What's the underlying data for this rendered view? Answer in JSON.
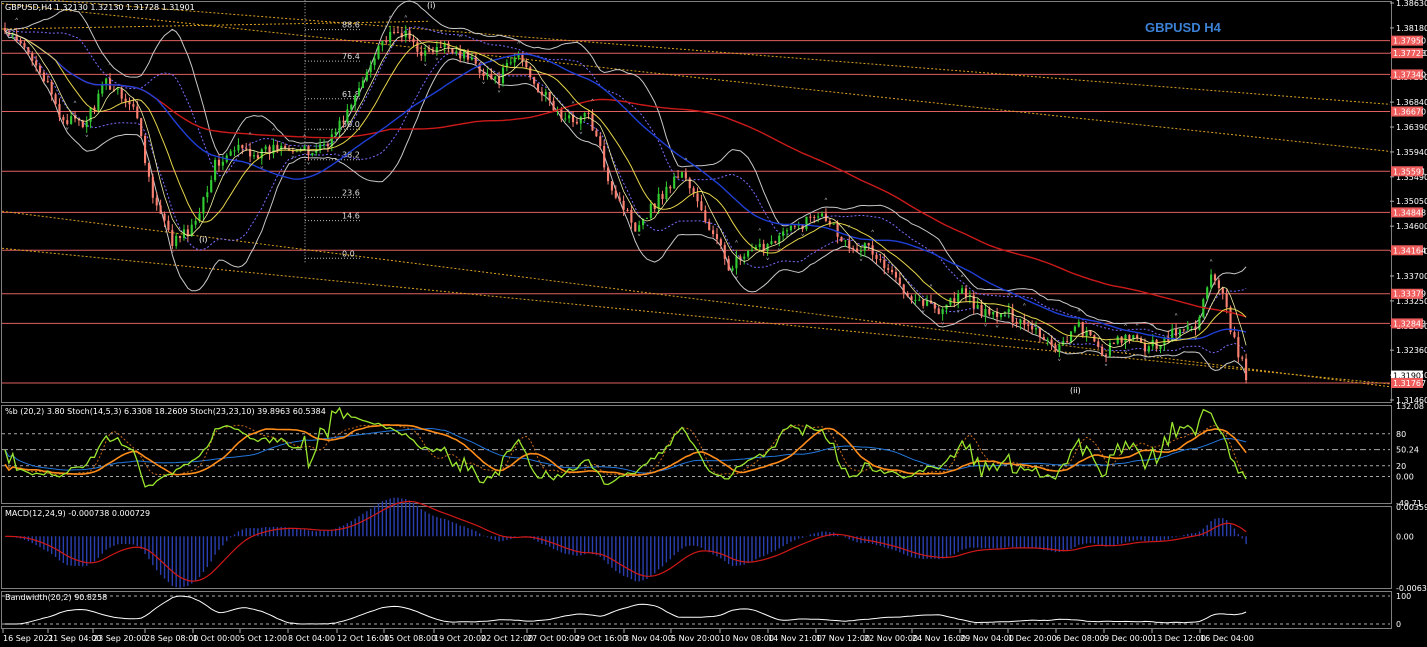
{
  "window": {
    "main_header": "GBPUSD,H4  1.32130 1.32130 1.31728 1.31901",
    "symbol_label": "GBPUSD H4",
    "wave_labels": [
      "(i)",
      "(i)",
      "(ii)"
    ]
  },
  "colors": {
    "background": "#000000",
    "bull_candle": "#32cd32",
    "bear_candle": "#fa8072",
    "ma_long": "#cc1a1a",
    "ma_mid": "#1f3fd6",
    "ma_short": "#e6d54a",
    "bollinger": "#c8c8c8",
    "hline": "#e06060",
    "channel": "#d9a020",
    "label_blue": "#3b82d6",
    "stoch_main": "#9ae62e",
    "stoch_orange": "#ff8c1a",
    "stoch_blue": "#2277dd",
    "macd_hist": "#2a3fb0",
    "macd_signal": "#d01818"
  },
  "chart_data": [
    {
      "type": "candlestick",
      "title": "GBPUSD H4",
      "ylim": [
        1.3146,
        1.3863
      ],
      "y_ticks": [
        "1.38630",
        "1.38180",
        "1.37730",
        "1.37290",
        "1.36840",
        "1.36390",
        "1.35940",
        "1.35490",
        "1.35050",
        "1.34600",
        "1.34150",
        "1.33700",
        "1.33250",
        "1.32800",
        "1.32360",
        "1.31910",
        "1.31460"
      ],
      "price_labels": [
        {
          "value": 1.3795,
          "label": "1.37950",
          "style": "red"
        },
        {
          "value": 1.37723,
          "label": "1.37723",
          "style": "red"
        },
        {
          "value": 1.3734,
          "label": "1.37340",
          "style": "red"
        },
        {
          "value": 1.3667,
          "label": "1.36670",
          "style": "red"
        },
        {
          "value": 1.35591,
          "label": "1.35591",
          "style": "red"
        },
        {
          "value": 1.34848,
          "label": "1.34848",
          "style": "red"
        },
        {
          "value": 1.34164,
          "label": "1.34164",
          "style": "red"
        },
        {
          "value": 1.33379,
          "label": "1.33379",
          "style": "red"
        },
        {
          "value": 1.32843,
          "label": "1.32843",
          "style": "red"
        },
        {
          "value": 1.31901,
          "label": "1.31901",
          "style": "current"
        },
        {
          "value": 1.31767,
          "label": "1.31767",
          "style": "red"
        }
      ],
      "fib_levels": [
        "88.6",
        "76.4",
        "61.8",
        "50.0",
        "38.2",
        "23.6",
        "14.6",
        "0.0"
      ],
      "x_labels": [
        "16 Sep 2021",
        "21 Sep 04:00",
        "23 Sep 20:00",
        "28 Sep 08:00",
        "1 Oct 00:00",
        "5 Oct 12:00",
        "8 Oct 04:00",
        "12 Oct 16:00",
        "15 Oct 08:00",
        "19 Oct 20:00",
        "22 Oct 12:00",
        "27 Oct 00:00",
        "29 Oct 16:00",
        "3 Nov 04:00",
        "5 Nov 20:00",
        "10 Nov 08:00",
        "14 Nov 21:00",
        "17 Nov 12:00",
        "22 Nov 00:00",
        "24 Nov 16:00",
        "29 Nov 04:00",
        "1 Dec 20:00",
        "6 Dec 08:00",
        "9 Dec 00:00",
        "13 Dec 12:00",
        "16 Dec 04:00"
      ],
      "anchor_path": [
        [
          0,
          1.381
        ],
        [
          8,
          1.376
        ],
        [
          14,
          1.366
        ],
        [
          20,
          1.364
        ],
        [
          26,
          1.372
        ],
        [
          30,
          1.37
        ],
        [
          34,
          1.366
        ],
        [
          38,
          1.351
        ],
        [
          43,
          1.343
        ],
        [
          48,
          1.3455
        ],
        [
          54,
          1.357
        ],
        [
          60,
          1.36
        ],
        [
          66,
          1.359
        ],
        [
          72,
          1.361
        ],
        [
          78,
          1.359
        ],
        [
          84,
          1.362
        ],
        [
          90,
          1.369
        ],
        [
          96,
          1.379
        ],
        [
          102,
          1.381
        ],
        [
          108,
          1.377
        ],
        [
          114,
          1.3785
        ],
        [
          120,
          1.376
        ],
        [
          126,
          1.372
        ],
        [
          132,
          1.377
        ],
        [
          138,
          1.37
        ],
        [
          144,
          1.365
        ],
        [
          150,
          1.366
        ],
        [
          156,
          1.353
        ],
        [
          162,
          1.346
        ],
        [
          168,
          1.351
        ],
        [
          174,
          1.356
        ],
        [
          180,
          1.347
        ],
        [
          186,
          1.339
        ],
        [
          192,
          1.341
        ],
        [
          198,
          1.344
        ],
        [
          204,
          1.346
        ],
        [
          210,
          1.349
        ],
        [
          216,
          1.343
        ],
        [
          222,
          1.342
        ],
        [
          228,
          1.337
        ],
        [
          234,
          1.333
        ],
        [
          240,
          1.331
        ],
        [
          246,
          1.334
        ],
        [
          252,
          1.33
        ],
        [
          258,
          1.33
        ],
        [
          264,
          1.328
        ],
        [
          270,
          1.324
        ],
        [
          276,
          1.328
        ],
        [
          282,
          1.323
        ],
        [
          288,
          1.326
        ],
        [
          294,
          1.324
        ],
        [
          300,
          1.3265
        ],
        [
          306,
          1.328
        ],
        [
          310,
          1.337
        ],
        [
          313,
          1.333
        ],
        [
          316,
          1.325
        ],
        [
          319,
          1.319
        ]
      ]
    },
    {
      "type": "line",
      "title": "%b (20,2) 3.80  Stoch(14,5,3) 6.3308 18.2609  Stoch(23,23,10) 39.8963 60.5384",
      "ylim": [
        -49.71,
        132.08
      ],
      "y_ticks": [
        "132.08",
        "80",
        "50.24",
        "20",
        "0.00",
        "-49.71"
      ],
      "levels": [
        80,
        50.24,
        20,
        0
      ]
    },
    {
      "type": "bar",
      "title": "MACD(12,24,9) -0.000738 0.000729",
      "ylim": [
        -0.006363,
        0.003599
      ],
      "y_ticks": [
        "0.003599",
        "0.00",
        "-0.006363"
      ]
    },
    {
      "type": "line",
      "title": "Bandwidth(20,2) 90.8258",
      "ylim": [
        0,
        100
      ],
      "y_ticks": [
        "100",
        "0"
      ],
      "levels": [
        100,
        0
      ]
    }
  ]
}
